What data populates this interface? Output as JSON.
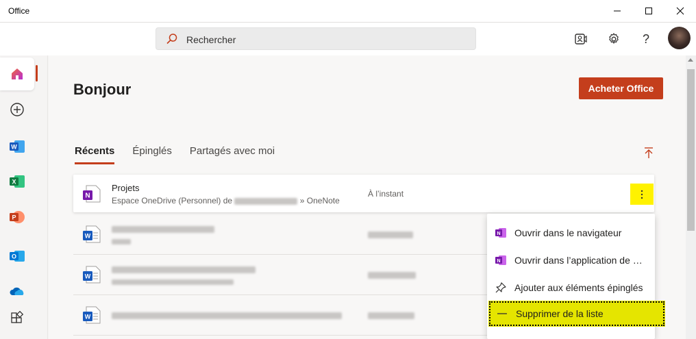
{
  "window": {
    "title": "Office"
  },
  "header": {
    "search_placeholder": "Rechercher"
  },
  "main": {
    "greeting": "Bonjour",
    "buy_button": "Acheter Office",
    "tabs": [
      {
        "label": "Récents",
        "active": true
      },
      {
        "label": "Épinglés",
        "active": false
      },
      {
        "label": "Partagés avec moi",
        "active": false
      }
    ],
    "files": [
      {
        "name": "Projets",
        "location_prefix": "Espace OneDrive (Personnel) de",
        "location_suffix": "» OneNote",
        "time": "À l’instant",
        "app": "onenote"
      },
      {
        "name": "",
        "location": "",
        "time": "",
        "app": "word"
      },
      {
        "name": "",
        "location": "",
        "time": "",
        "app": "word"
      },
      {
        "name": "",
        "location": "",
        "time": "",
        "app": "word"
      }
    ]
  },
  "context_menu": {
    "items": [
      {
        "label": "Ouvrir dans le navigateur",
        "icon": "onenote-icon"
      },
      {
        "label": "Ouvrir dans l’application de bureau",
        "icon": "onenote-icon"
      },
      {
        "label": "Ajouter aux éléments épinglés",
        "icon": "pin-icon"
      },
      {
        "label": "Supprimer de la liste",
        "icon": "minus-icon",
        "highlighted": true
      }
    ]
  },
  "colors": {
    "accent": "#c43e1c",
    "highlight": "#fff200",
    "onenote": "#7719aa",
    "word": "#185abd",
    "excel": "#107c41",
    "powerpoint": "#c43e1c",
    "outlook": "#0078d4",
    "onedrive": "#0364b8"
  }
}
